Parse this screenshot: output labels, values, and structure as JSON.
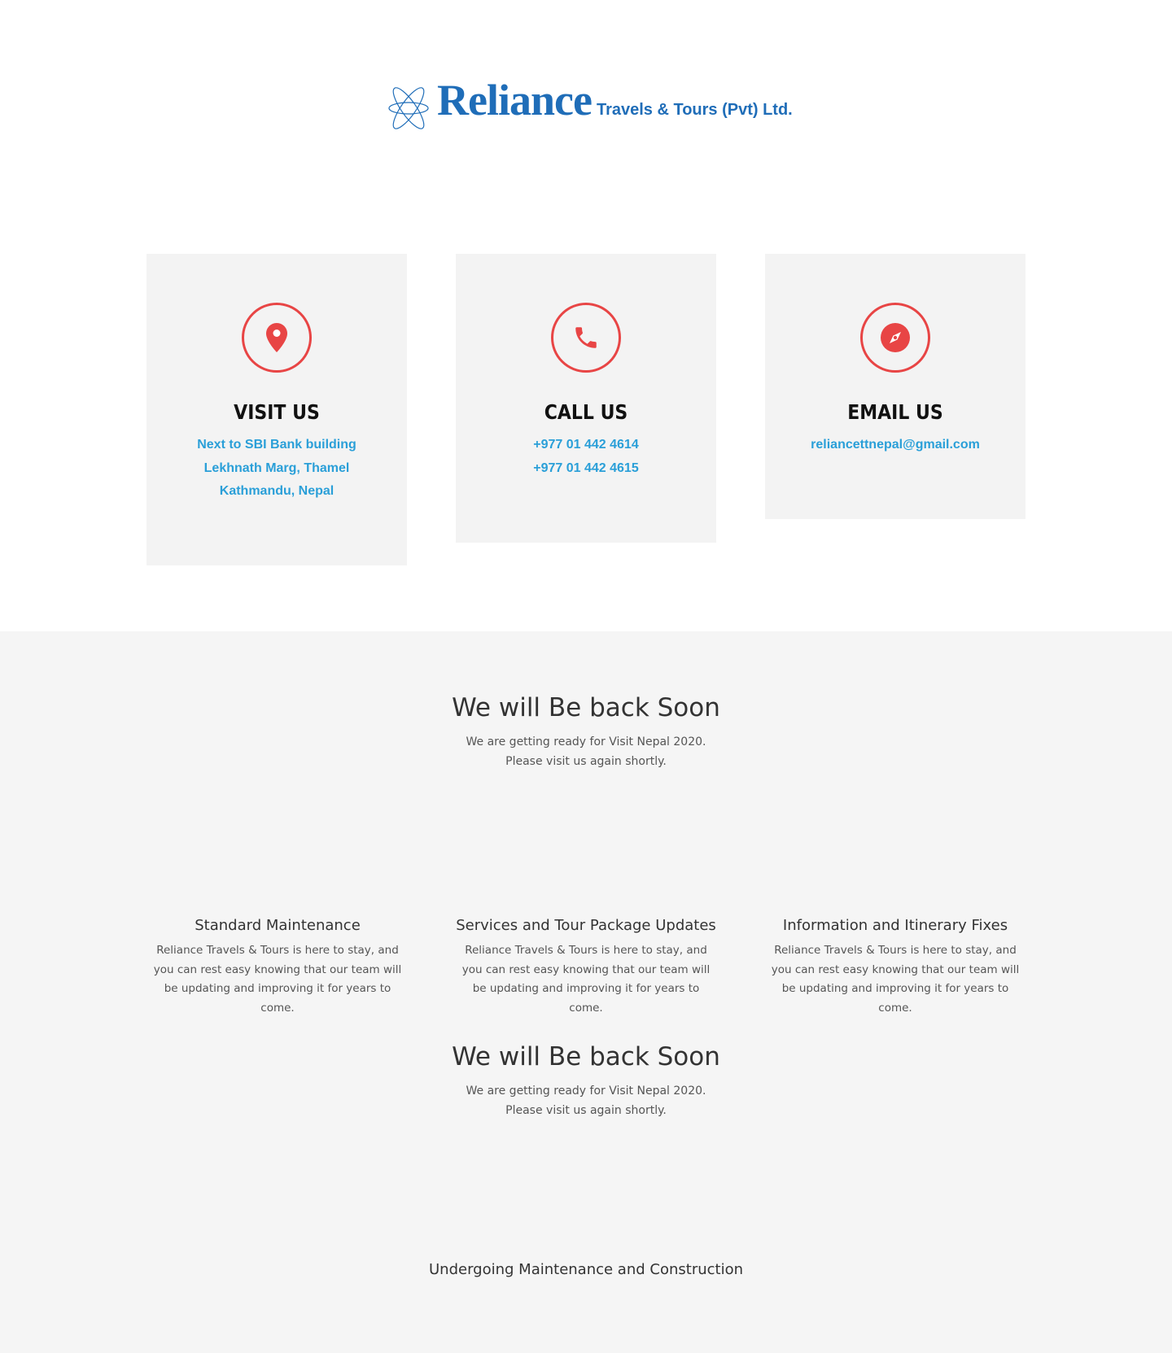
{
  "brand": {
    "name": "Reliance",
    "tagline": "Travels & Tours (Pvt) Ltd.",
    "color": "#1f6db8"
  },
  "colors": {
    "accent": "#e84545",
    "link": "#2a9fd8"
  },
  "contacts": [
    {
      "icon": "map-pin-icon",
      "title": "VISIT US",
      "lines": [
        "Next to SBI Bank building",
        "Lekhnath Marg, Thamel",
        "Kathmandu, Nepal"
      ]
    },
    {
      "icon": "phone-icon",
      "title": "CALL US",
      "lines": [
        "+977 01 442 4614",
        "+977 01 442 4615"
      ]
    },
    {
      "icon": "compass-icon",
      "title": "EMAIL US",
      "lines": [
        "reliancettnepal@gmail.com"
      ]
    }
  ],
  "notice1": {
    "title": "We will Be back Soon",
    "line1": "We are getting ready for Visit Nepal 2020.",
    "line2": "Please visit us again shortly."
  },
  "features": [
    {
      "title": "Standard Maintenance",
      "text": "Reliance Travels & Tours is here to stay, and you can rest easy knowing that our team will be updating and improving it for years to come."
    },
    {
      "title": "Services and Tour Package Updates",
      "text": "Reliance Travels & Tours is here to stay, and you can rest easy knowing that our team will be updating and improving it for years to come."
    },
    {
      "title": "Information and Itinerary Fixes",
      "text": "Reliance Travels & Tours is here to stay, and you can rest easy knowing that our team will be updating and improving it for years to come."
    }
  ],
  "notice2": {
    "title": "We will Be back Soon",
    "line1": "We are getting ready for Visit Nepal 2020.",
    "line2": "Please visit us again shortly."
  },
  "footer_label": "Undergoing Maintenance and Construction"
}
